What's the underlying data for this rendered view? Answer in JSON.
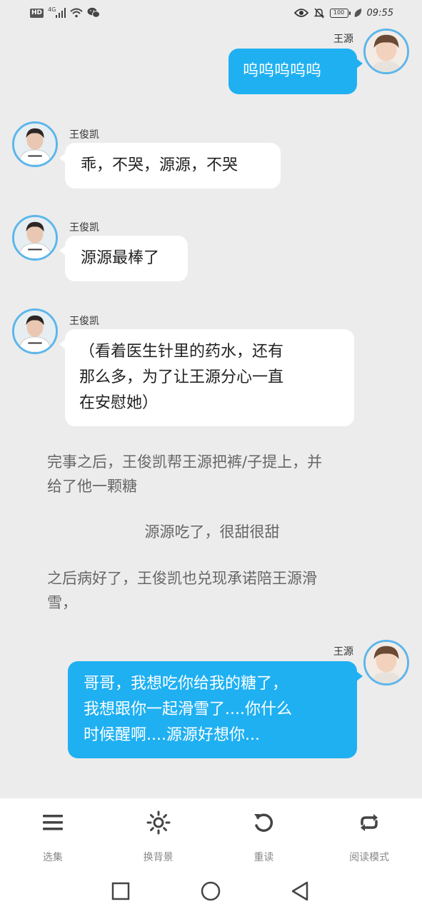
{
  "status_bar": {
    "network_badge": "HD",
    "network_type": "4G",
    "battery": "100",
    "time": "09:55",
    "icons": [
      "signal-icon",
      "wifi-icon",
      "wechat-icon",
      "eye-icon",
      "mute-bell-icon",
      "leaf-icon"
    ]
  },
  "messages": [
    {
      "speaker": "王源",
      "side": "right",
      "text": "呜呜呜呜呜"
    },
    {
      "speaker": "王俊凯",
      "side": "left",
      "text": "乖，不哭，源源，不哭"
    },
    {
      "speaker": "王俊凯",
      "side": "left",
      "text": "源源最棒了"
    },
    {
      "speaker": "王俊凯",
      "side": "left",
      "lines": [
        "（看着医生针里的药水，还有",
        "那么多，为了让王源分心一直",
        "在安慰她）"
      ]
    }
  ],
  "narration": [
    {
      "lines": [
        "完事之后，王俊凯帮王源把裤/子提上，并",
        "给了他一颗糖"
      ]
    },
    {
      "lines": [
        "源源吃了，很甜很甜"
      ]
    },
    {
      "lines": [
        "之后病好了，王俊凯也兑现承诺陪王源滑",
        "雪，"
      ]
    }
  ],
  "last_message": {
    "speaker": "王源",
    "lines": [
      "哥哥，我想吃你给我的糖了，",
      "我想跟你一起滑雪了....你什么",
      "时候醒啊....源源好想你..."
    ]
  },
  "toolbar": [
    {
      "label": "选集",
      "icon": "menu-icon"
    },
    {
      "label": "换背景",
      "icon": "brightness-icon"
    },
    {
      "label": "重读",
      "icon": "replay-icon"
    },
    {
      "label": "阅读模式",
      "icon": "repeat-icon"
    }
  ],
  "navbar": [
    "recent-apps-icon",
    "home-icon",
    "back-icon"
  ],
  "colors": {
    "background": "#ececec",
    "blue_bubble": "#1fb0f2",
    "avatar_ring": "#5db6ea"
  }
}
